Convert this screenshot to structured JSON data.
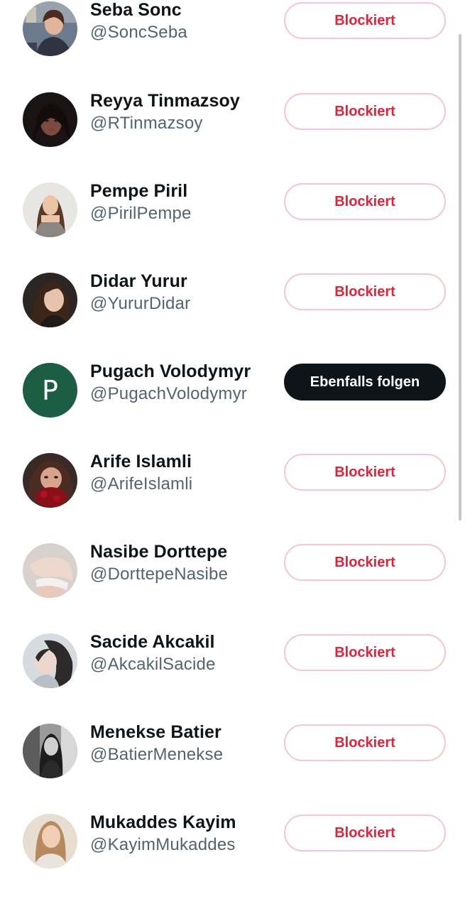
{
  "users": [
    {
      "name": "Seba Sonc",
      "handle": "@SoncSeba",
      "button": "Blockiert",
      "state": "blocked"
    },
    {
      "name": "Reyya Tinmazsoy",
      "handle": "@RTinmazsoy",
      "button": "Blockiert",
      "state": "blocked"
    },
    {
      "name": "Pempe Piril",
      "handle": "@PirilPempe",
      "button": "Blockiert",
      "state": "blocked"
    },
    {
      "name": "Didar Yurur",
      "handle": "@YururDidar",
      "button": "Blockiert",
      "state": "blocked"
    },
    {
      "name": "Pugach Volodymyr",
      "handle": "@PugachVolodymyr",
      "button": "Ebenfalls folgen",
      "state": "follow",
      "avatar_letter": "P"
    },
    {
      "name": "Arife Islamli",
      "handle": "@ArifeIslamli",
      "button": "Blockiert",
      "state": "blocked"
    },
    {
      "name": "Nasibe Dorttepe",
      "handle": "@DorttepeNasibe",
      "button": "Blockiert",
      "state": "blocked"
    },
    {
      "name": "Sacide Akcakil",
      "handle": "@AkcakilSacide",
      "button": "Blockiert",
      "state": "blocked"
    },
    {
      "name": "Menekse Batier",
      "handle": "@BatierMenekse",
      "button": "Blockiert",
      "state": "blocked"
    },
    {
      "name": "Mukaddes Kayim",
      "handle": "@KayimMukaddes",
      "button": "Blockiert",
      "state": "blocked"
    }
  ],
  "colors": {
    "blocked_text": "#e0243a",
    "blocked_border": "#f5c6cc",
    "follow_bg": "#0f1419",
    "letter_avatar_bg": "#1c5d45"
  }
}
